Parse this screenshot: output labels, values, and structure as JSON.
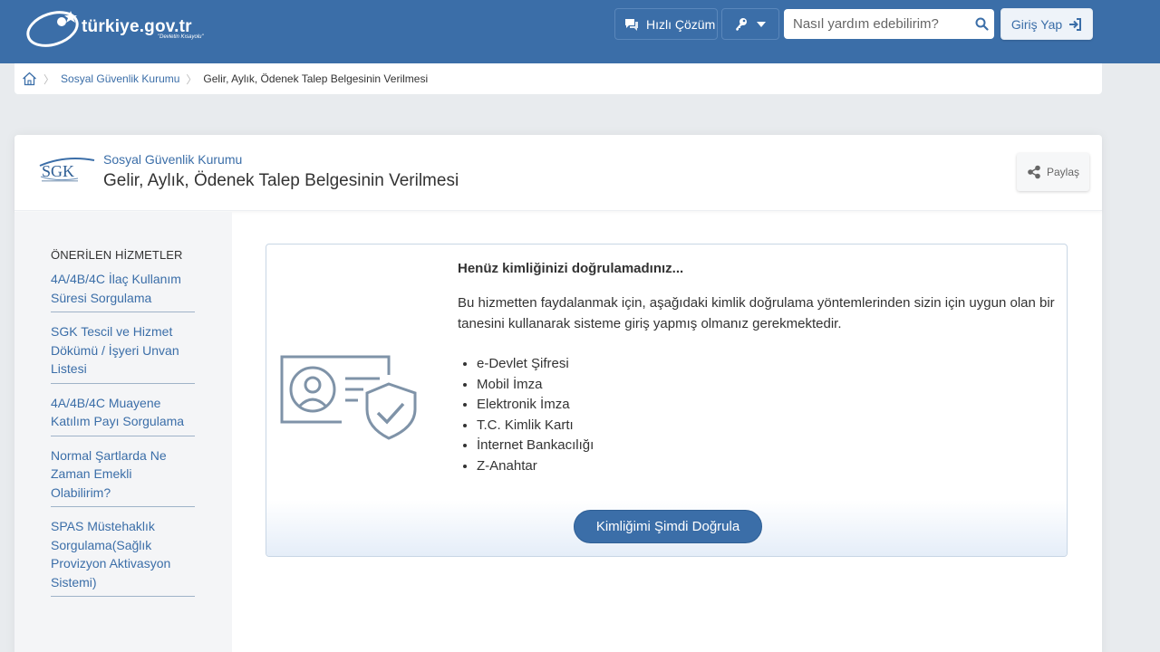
{
  "header": {
    "logo_text": "türkiye.gov.tr",
    "logo_slogan": "\"Devletin Kısayolu\"",
    "quick_solution_label": "Hızlı Çözüm",
    "search_placeholder": "Nasıl yardım edebilirim?",
    "login_label": "Giriş Yap"
  },
  "breadcrumb": {
    "items": [
      "Sosyal Güvenlik Kurumu",
      "Gelir, Aylık, Ödenek Talep Belgesinin Verilmesi"
    ]
  },
  "service": {
    "logo_text": "SGK",
    "institution": "Sosyal Güvenlik Kurumu",
    "title": "Gelir, Aylık, Ödenek Talep Belgesinin Verilmesi",
    "share_label": "Paylaş"
  },
  "sidebar": {
    "title": "ÖNERİLEN HİZMETLER",
    "items": [
      "4A/4B/4C İlaç Kullanım Süresi Sorgulama",
      "SGK Tescil ve Hizmet Dökümü / İşyeri Unvan Listesi",
      "4A/4B/4C Muayene Katılım Payı Sorgulama",
      "Normal Şartlarda Ne Zaman Emekli Olabilirim?",
      "SPAS Müstehaklık Sorgulama(Sağlık Provizyon Aktivasyon Sistemi)"
    ]
  },
  "auth": {
    "title": "Henüz kimliğinizi doğrulamadınız...",
    "description": "Bu hizmetten faydalanmak için, aşağıdaki kimlik doğrulama yöntemlerinden sizin için uygun olan bir tanesini kullanarak sisteme giriş yapmış olmanız gerekmektedir.",
    "methods": [
      "e-Devlet Şifresi",
      "Mobil İmza",
      "Elektronik İmza",
      "T.C. Kimlik Kartı",
      "İnternet Bankacılığı",
      "Z-Anahtar"
    ],
    "verify_label": "Kimliğimi Şimdi Doğrula"
  },
  "colors": {
    "brand_blue": "#3b6ea8",
    "page_bg": "#e8ebee",
    "icon_gray": "#7f93a8"
  }
}
